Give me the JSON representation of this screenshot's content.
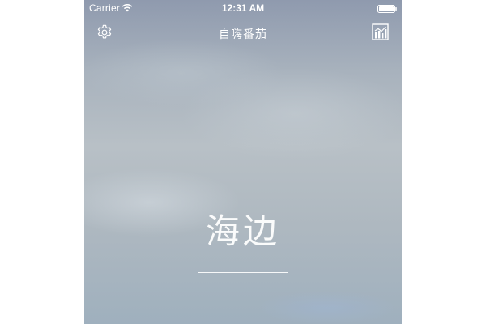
{
  "status_bar": {
    "carrier": "Carrier",
    "time": "12:31 AM",
    "wifi_icon": "wifi-icon",
    "battery_icon": "battery-icon"
  },
  "nav": {
    "title": "自嗨番茄",
    "left_icon": "gear-icon",
    "right_icon": "bar-chart-icon"
  },
  "main": {
    "scene_label": "海边"
  },
  "colors": {
    "foreground": "#ffffff",
    "background_top": "#8f9aae",
    "background_bottom": "#9fb0be"
  }
}
